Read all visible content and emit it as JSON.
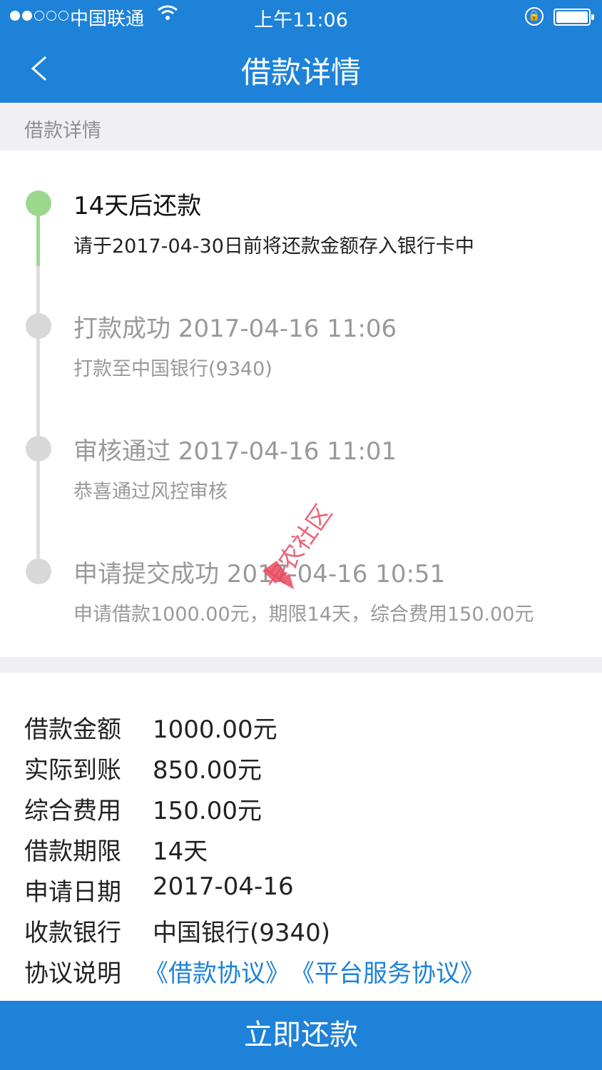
{
  "status_bar": {
    "carrier": "中国联通",
    "time": "上午11:06"
  },
  "nav": {
    "title": "借款详情"
  },
  "section_header": "借款详情",
  "timeline": [
    {
      "title": "14天后还款",
      "subtitle": "请于2017-04-30日前将还款金额存入银行卡中",
      "active": true
    },
    {
      "title": "打款成功 2017-04-16 11:06",
      "subtitle": "打款至中国银行(9340)",
      "active": false
    },
    {
      "title": "审核通过 2017-04-16 11:01",
      "subtitle": "恭喜通过风控审核",
      "active": false
    },
    {
      "title": "申请提交成功 2017-04-16 10:51",
      "subtitle": "申请借款1000.00元，期限14天，综合费用150.00元",
      "active": false
    }
  ],
  "details": [
    {
      "label": "借款金额",
      "value": "1000.00元"
    },
    {
      "label": "实际到账",
      "value": "850.00元"
    },
    {
      "label": "综合费用",
      "value": "150.00元"
    },
    {
      "label": "借款期限",
      "value": "14天"
    },
    {
      "label": "申请日期",
      "value": "2017-04-16"
    },
    {
      "label": "收款银行",
      "value": "中国银行(9340)"
    }
  ],
  "agreement": {
    "label": "协议说明",
    "link1": "《借款协议》",
    "link2": "《平台服务协议》"
  },
  "watermark_text": "卡农社区",
  "repay_button": "立即还款",
  "colors": {
    "primary": "#1e82d8",
    "timeline_active": "#9bd88e",
    "timeline_inactive": "#d8d8d8",
    "section_bg": "#efeff4"
  }
}
